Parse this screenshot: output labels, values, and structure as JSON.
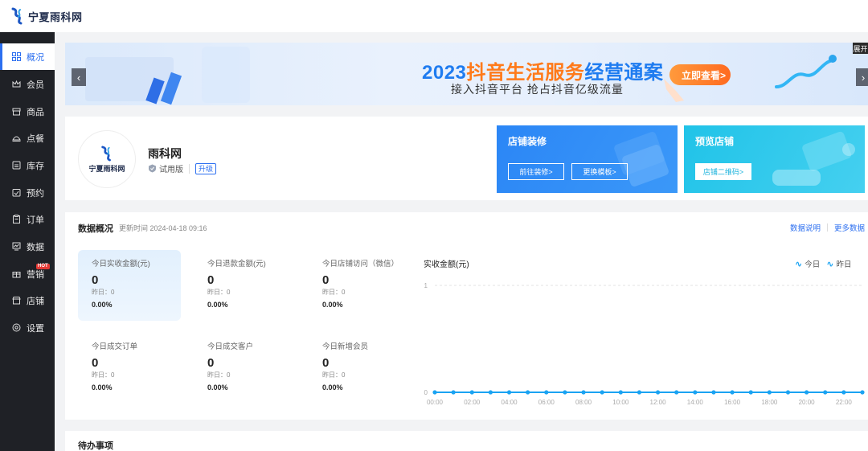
{
  "brand": {
    "name": "宁夏雨科网"
  },
  "sidebar": {
    "items": [
      {
        "label": "概况",
        "icon": "dashboard-icon"
      },
      {
        "label": "会员",
        "icon": "crown-icon"
      },
      {
        "label": "商品",
        "icon": "store-icon"
      },
      {
        "label": "点餐",
        "icon": "dish-icon"
      },
      {
        "label": "库存",
        "icon": "inventory-icon"
      },
      {
        "label": "预约",
        "icon": "calendar-check-icon"
      },
      {
        "label": "订单",
        "icon": "clipboard-icon"
      },
      {
        "label": "数据",
        "icon": "chart-icon"
      },
      {
        "label": "营销",
        "icon": "gift-icon",
        "badge": "HOT"
      },
      {
        "label": "店铺",
        "icon": "shop-icon"
      },
      {
        "label": "设置",
        "icon": "gear-icon"
      }
    ]
  },
  "banner": {
    "title_prefix": "2023",
    "title_orange": "抖音生活服务",
    "title_blue": "经营通案",
    "subtitle": "接入抖音平台  抢占抖音亿级流量",
    "button": "立即查看>",
    "expand": "展开"
  },
  "store": {
    "name": "雨科网",
    "logo_text": "宁夏雨科网",
    "version": "试用版",
    "upgrade": "升级",
    "promo1": {
      "title": "店铺装修",
      "btn1": "前往装修>",
      "btn2": "更换模板>"
    },
    "promo2": {
      "title": "预览店铺",
      "btn1": "店铺二维码>"
    }
  },
  "overview": {
    "title": "数据概况",
    "updated": "更新时间 2024-04-18 09:16",
    "link1": "数据说明",
    "link2": "更多数据",
    "metrics": [
      {
        "label": "今日实收金额(元)",
        "value": "0",
        "yesterday": "昨日：0",
        "pct": "0.00%"
      },
      {
        "label": "今日退款金额(元)",
        "value": "0",
        "yesterday": "昨日：0",
        "pct": "0.00%"
      },
      {
        "label": "今日店铺访问（微信）",
        "value": "0",
        "yesterday": "昨日：0",
        "pct": "0.00%"
      },
      {
        "label": "今日成交订单",
        "value": "0",
        "yesterday": "昨日：0",
        "pct": "0.00%"
      },
      {
        "label": "今日成交客户",
        "value": "0",
        "yesterday": "昨日：0",
        "pct": "0.00%"
      },
      {
        "label": "今日新增会员",
        "value": "0",
        "yesterday": "昨日：0",
        "pct": "0.00%"
      }
    ]
  },
  "chart_data": {
    "type": "line",
    "title": "实收金额(元)",
    "x": [
      "00:00",
      "01:00",
      "02:00",
      "03:00",
      "04:00",
      "05:00",
      "06:00",
      "07:00",
      "08:00",
      "09:00",
      "10:00",
      "11:00",
      "12:00",
      "13:00",
      "14:00",
      "15:00",
      "16:00",
      "17:00",
      "18:00",
      "19:00",
      "20:00",
      "21:00",
      "22:00",
      "23:00"
    ],
    "xticks": [
      "00:00",
      "02:00",
      "04:00",
      "06:00",
      "08:00",
      "10:00",
      "12:00",
      "14:00",
      "16:00",
      "18:00",
      "20:00",
      "22:00"
    ],
    "series": [
      {
        "name": "今日",
        "values": [
          0,
          0,
          0,
          0,
          0,
          0,
          0,
          0,
          0,
          0,
          0,
          0,
          0,
          0,
          0,
          0,
          0,
          0,
          0,
          0,
          0,
          0,
          0,
          0
        ],
        "color": "#1aa3f2"
      },
      {
        "name": "昨日",
        "values": [
          0,
          0,
          0,
          0,
          0,
          0,
          0,
          0,
          0,
          0,
          0,
          0,
          0,
          0,
          0,
          0,
          0,
          0,
          0,
          0,
          0,
          0,
          0,
          0
        ],
        "color": "#1aa3f2"
      }
    ],
    "ylim": [
      0,
      1
    ],
    "yticks": [
      "0",
      "1"
    ],
    "legend": "top-right",
    "grid": true
  },
  "todo": {
    "title": "待办事项"
  }
}
